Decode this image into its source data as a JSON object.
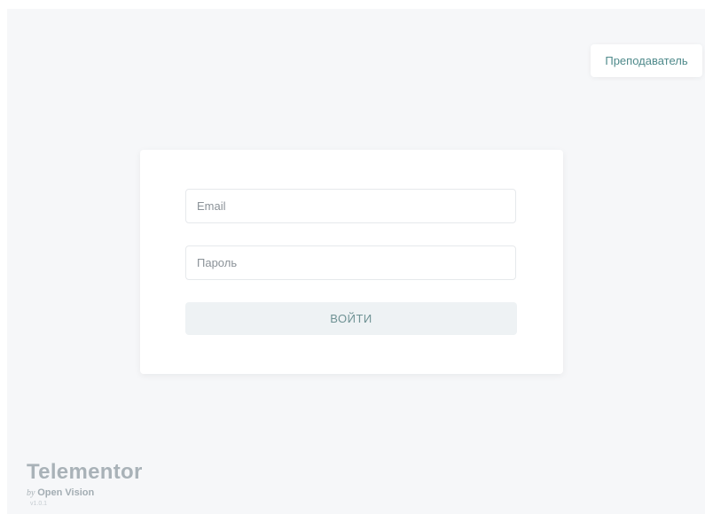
{
  "header": {
    "role_button_label": "Преподаватель"
  },
  "login": {
    "email_placeholder": "Email",
    "password_placeholder": "Пароль",
    "submit_label": "ВОЙТИ"
  },
  "footer": {
    "brand_name": "Telementor",
    "by_label": "by",
    "company_name": "Open Vision",
    "version": "v1.0.1"
  },
  "colors": {
    "page_background": "#f6f7f9",
    "accent_text": "#4f8a8b",
    "button_background": "#eef2f4",
    "brand_gray": "#a9b2b8"
  }
}
